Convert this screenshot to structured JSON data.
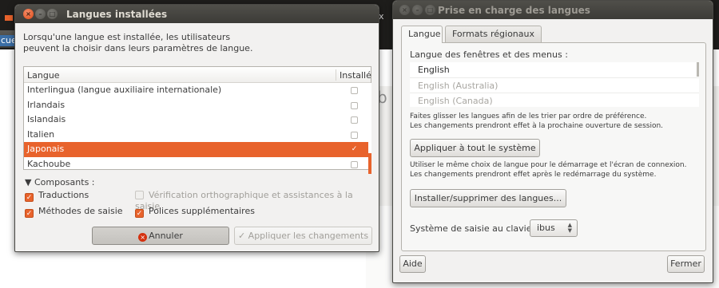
{
  "background": {
    "left_tab_text": "cue",
    "right_tab_text": "x",
    "right_letter": "b"
  },
  "left_window": {
    "title": "Langues installées",
    "intro_line1": "Lorsqu'une langue est installée, les utilisateurs",
    "intro_line2": "peuvent la choisir dans leurs paramètres de langue.",
    "col_language": "Langue",
    "col_installed": "Installé",
    "rows": [
      {
        "name": "Interlingua (langue auxiliaire internationale)",
        "installed": false,
        "selected": false
      },
      {
        "name": "Irlandais",
        "installed": false,
        "selected": false
      },
      {
        "name": "Islandais",
        "installed": false,
        "selected": false
      },
      {
        "name": "Italien",
        "installed": false,
        "selected": false
      },
      {
        "name": "Japonais",
        "installed": true,
        "selected": true
      },
      {
        "name": "Kachoube",
        "installed": false,
        "selected": false
      }
    ],
    "components_label": "Composants :",
    "components": {
      "translations": {
        "label": "Traductions",
        "checked": true,
        "enabled": true
      },
      "spellcheck": {
        "label": "Vérification orthographique et assistances à la saisie",
        "checked": false,
        "enabled": false
      },
      "input_methods": {
        "label": "Méthodes de saisie",
        "checked": true,
        "enabled": true
      },
      "extra_fonts": {
        "label": "Polices supplémentaires",
        "checked": true,
        "enabled": true
      }
    },
    "cancel_label": "Annuler",
    "apply_label": "Appliquer les changements",
    "selection_color": "#e8632c"
  },
  "right_window": {
    "title": "Prise en charge des langues",
    "tabs": [
      {
        "label": "Langue",
        "active": true
      },
      {
        "label": "Formats régionaux",
        "active": false
      }
    ],
    "menu_lang_label": "Langue des fenêtres et des menus :",
    "languages": [
      "English",
      "English (Australia)",
      "English (Canada)"
    ],
    "hint_line1": "Faites glisser les langues afin de les trier par ordre de préférence.",
    "hint_line2": "Les changements prendront effet à la prochaine ouverture de session.",
    "apply_system_label": "Appliquer à tout le système",
    "login_line1": "Utiliser le même choix de langue pour le démarrage et l'écran de connexion.",
    "login_line2": "Les changements prendront effet après le redémarrage du système.",
    "install_label": "Installer/supprimer des langues...",
    "keyboard_label": "Système de saisie au clavier :",
    "keyboard_value": "ibus",
    "help_label": "Aide",
    "close_label": "Fermer"
  }
}
